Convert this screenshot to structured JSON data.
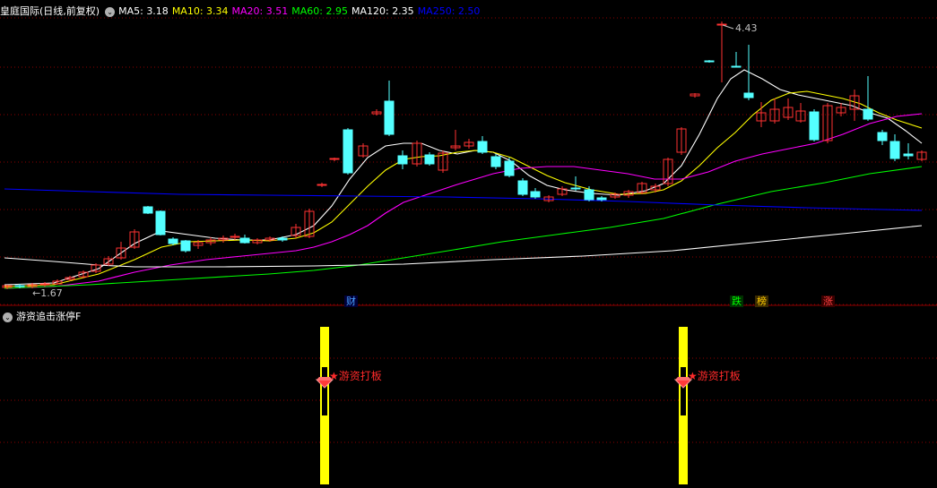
{
  "header": {
    "title": "皇庭国际(日线,前复权)",
    "dropdown_glyph": "⌄",
    "ma": [
      {
        "label": "MA5:",
        "value": "3.18",
        "color": "#ffffff"
      },
      {
        "label": "MA10:",
        "value": "3.34",
        "color": "#ffff00"
      },
      {
        "label": "MA20:",
        "value": "3.51",
        "color": "#ff00ff"
      },
      {
        "label": "MA60:",
        "value": "2.95",
        "color": "#00ff00"
      },
      {
        "label": "MA120:",
        "value": "2.35",
        "color": "#ffffff"
      },
      {
        "label": "MA250:",
        "value": "2.50",
        "color": "#0000ff"
      }
    ]
  },
  "price_labels": {
    "high": "4.43",
    "low": "1.67",
    "low_arrow": "←"
  },
  "event_tags": [
    {
      "text": "财",
      "color": "#4aa0ff",
      "bg": "#00003a"
    },
    {
      "text": "跌",
      "color": "#00ff00",
      "bg": "#003000"
    },
    {
      "text": "榜",
      "color": "#ffcc00",
      "bg": "#3a2a00"
    },
    {
      "text": "涨",
      "color": "#ff4040",
      "bg": "#3a0000"
    }
  ],
  "indicator": {
    "title": "游资追击涨停F",
    "toggle_glyph": "⌄",
    "signal_label": "★游资打板",
    "signal_count": 2,
    "bar_color": "#ffff00"
  },
  "colors": {
    "up_candle": "#ff3232",
    "down_candle": "#54ffff",
    "grid": "#8b0000"
  },
  "chart_data": {
    "type": "candlestick",
    "price_high": 4.43,
    "price_low": 1.67,
    "series": [
      {
        "name": "MA5",
        "color": "#ffffff"
      },
      {
        "name": "MA10",
        "color": "#ffff00"
      },
      {
        "name": "MA20",
        "color": "#ff00ff"
      },
      {
        "name": "MA60",
        "color": "#00ff00"
      },
      {
        "name": "MA120",
        "color": "#ffffff"
      },
      {
        "name": "MA250",
        "color": "#0000ff"
      }
    ]
  }
}
